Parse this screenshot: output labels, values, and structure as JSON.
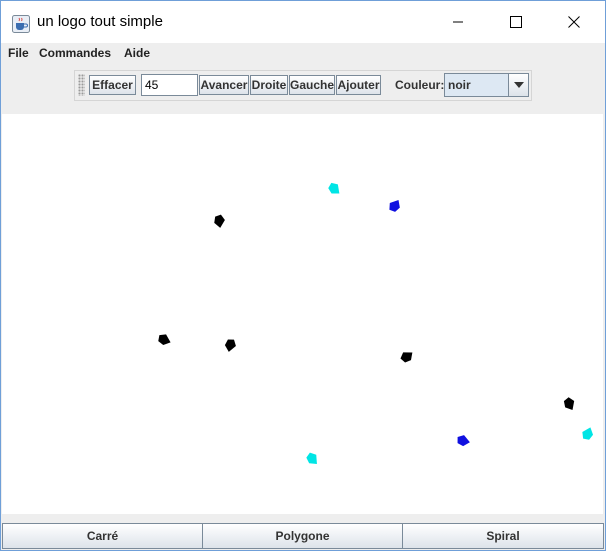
{
  "window": {
    "title": "un logo tout simple"
  },
  "menubar": {
    "items": [
      "File",
      "Commandes",
      "Aide"
    ]
  },
  "toolbar": {
    "effacer_label": "Effacer",
    "step_value": "45",
    "avancer_label": "Avancer",
    "droite_label": "Droite",
    "gauche_label": "Gauche",
    "ajouter_label": "Ajouter",
    "couleur_label": "Couleur:",
    "couleur_selected": "noir"
  },
  "bottom_buttons": {
    "carre": "Carré",
    "polygone": "Polygone",
    "spiral": "Spiral"
  },
  "turtles": [
    {
      "color": "#00e5e5"
    },
    {
      "color": "#1010e0"
    },
    {
      "color": "#000000"
    },
    {
      "color": "#000000"
    },
    {
      "color": "#000000"
    },
    {
      "color": "#000000"
    },
    {
      "color": "#000000"
    },
    {
      "color": "#1010e0"
    },
    {
      "color": "#00e5e5"
    },
    {
      "color": "#00e5e5"
    }
  ]
}
